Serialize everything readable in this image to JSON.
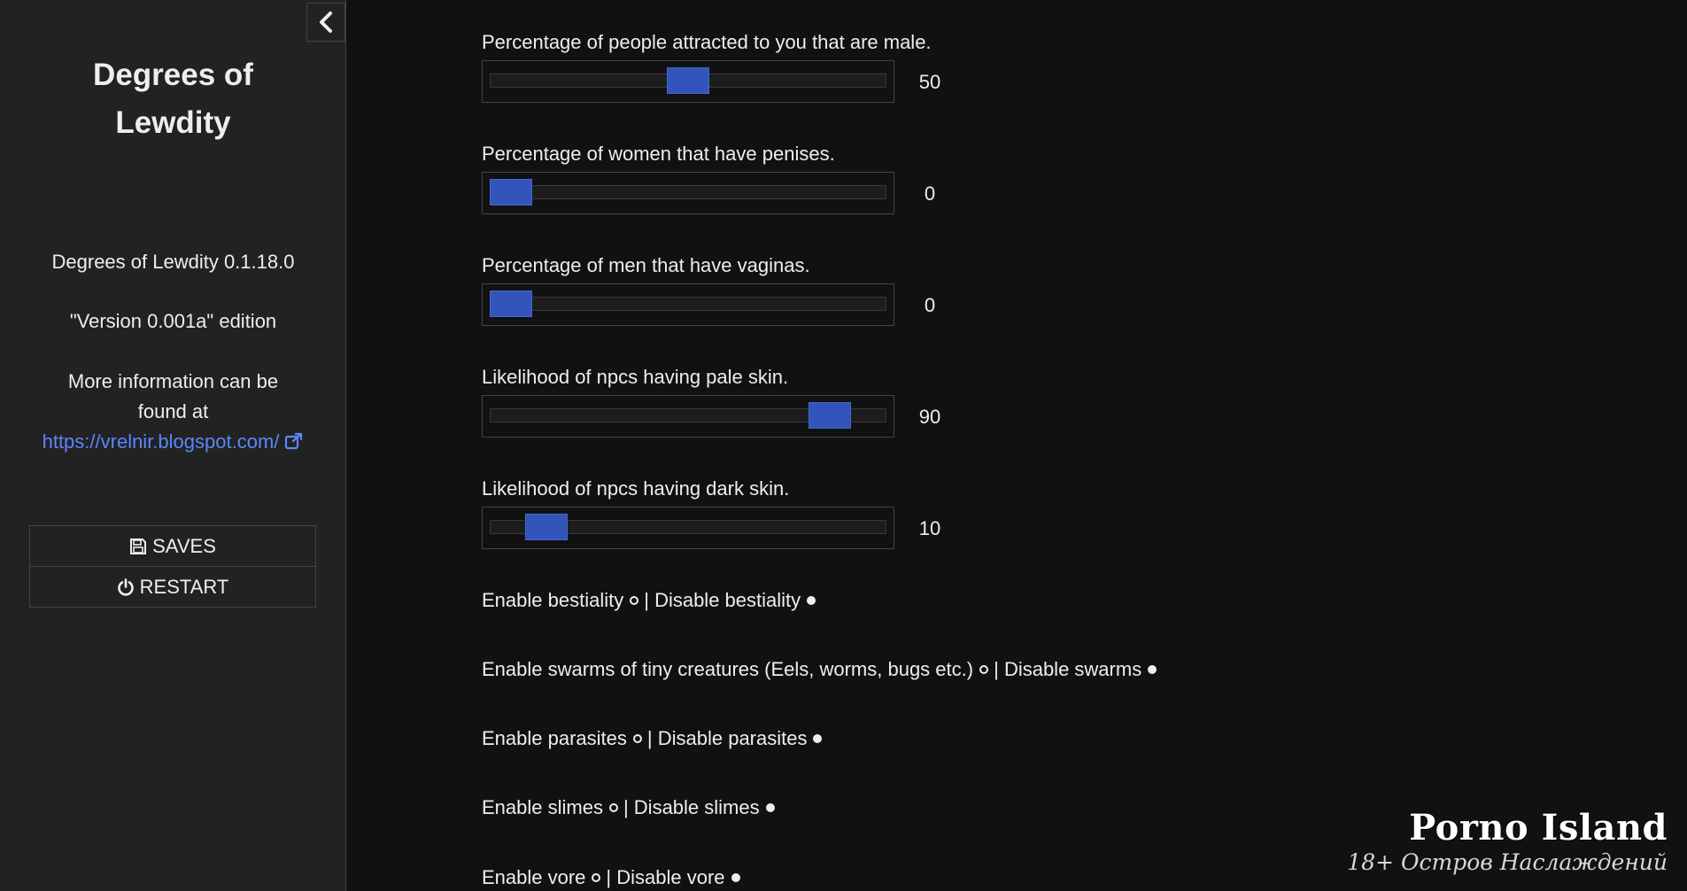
{
  "sidebar": {
    "title": "Degrees of Lewdity",
    "version": "Degrees of Lewdity 0.1.18.0",
    "edition": "\"Version 0.001a\" edition",
    "info": "More information can be found at",
    "link": "https://vrelnir.blogspot.com/",
    "buttons": {
      "saves": "SAVES",
      "restart": "RESTART"
    }
  },
  "sliders": [
    {
      "label": "Percentage of people attracted to you that are male.",
      "value": 50,
      "display": "50"
    },
    {
      "label": "Percentage of women that have penises.",
      "value": 0,
      "display": "0"
    },
    {
      "label": "Percentage of men that have vaginas.",
      "value": 0,
      "display": "0"
    },
    {
      "label": "Likelihood of npcs having pale skin.",
      "value": 90,
      "display": "90"
    },
    {
      "label": "Likelihood of npcs having dark skin.",
      "value": 10,
      "display": "10"
    }
  ],
  "toggles": [
    {
      "enable": "Enable bestiality",
      "disable": "Disable bestiality",
      "selected": "disable"
    },
    {
      "enable": "Enable swarms of tiny creatures (Eels, worms, bugs etc.)",
      "disable": "Disable swarms",
      "selected": "disable"
    },
    {
      "enable": "Enable parasites",
      "disable": "Disable parasites",
      "selected": "disable"
    },
    {
      "enable": "Enable slimes",
      "disable": "Disable slimes",
      "selected": "disable"
    },
    {
      "enable": "Enable vore",
      "disable": "Disable vore",
      "selected": "disable"
    }
  ],
  "separator": "|",
  "watermark": {
    "title": "Porno Island",
    "subtitle": "18+ Остров Наслаждений"
  },
  "colors": {
    "background": "#111111",
    "sidebar": "#222222",
    "accent": "#3355bb",
    "link": "#5a86ff"
  },
  "icons": {
    "collapse": "chevron-left-icon",
    "saves": "floppy-disk-icon",
    "restart": "power-icon",
    "external": "external-link-icon"
  }
}
